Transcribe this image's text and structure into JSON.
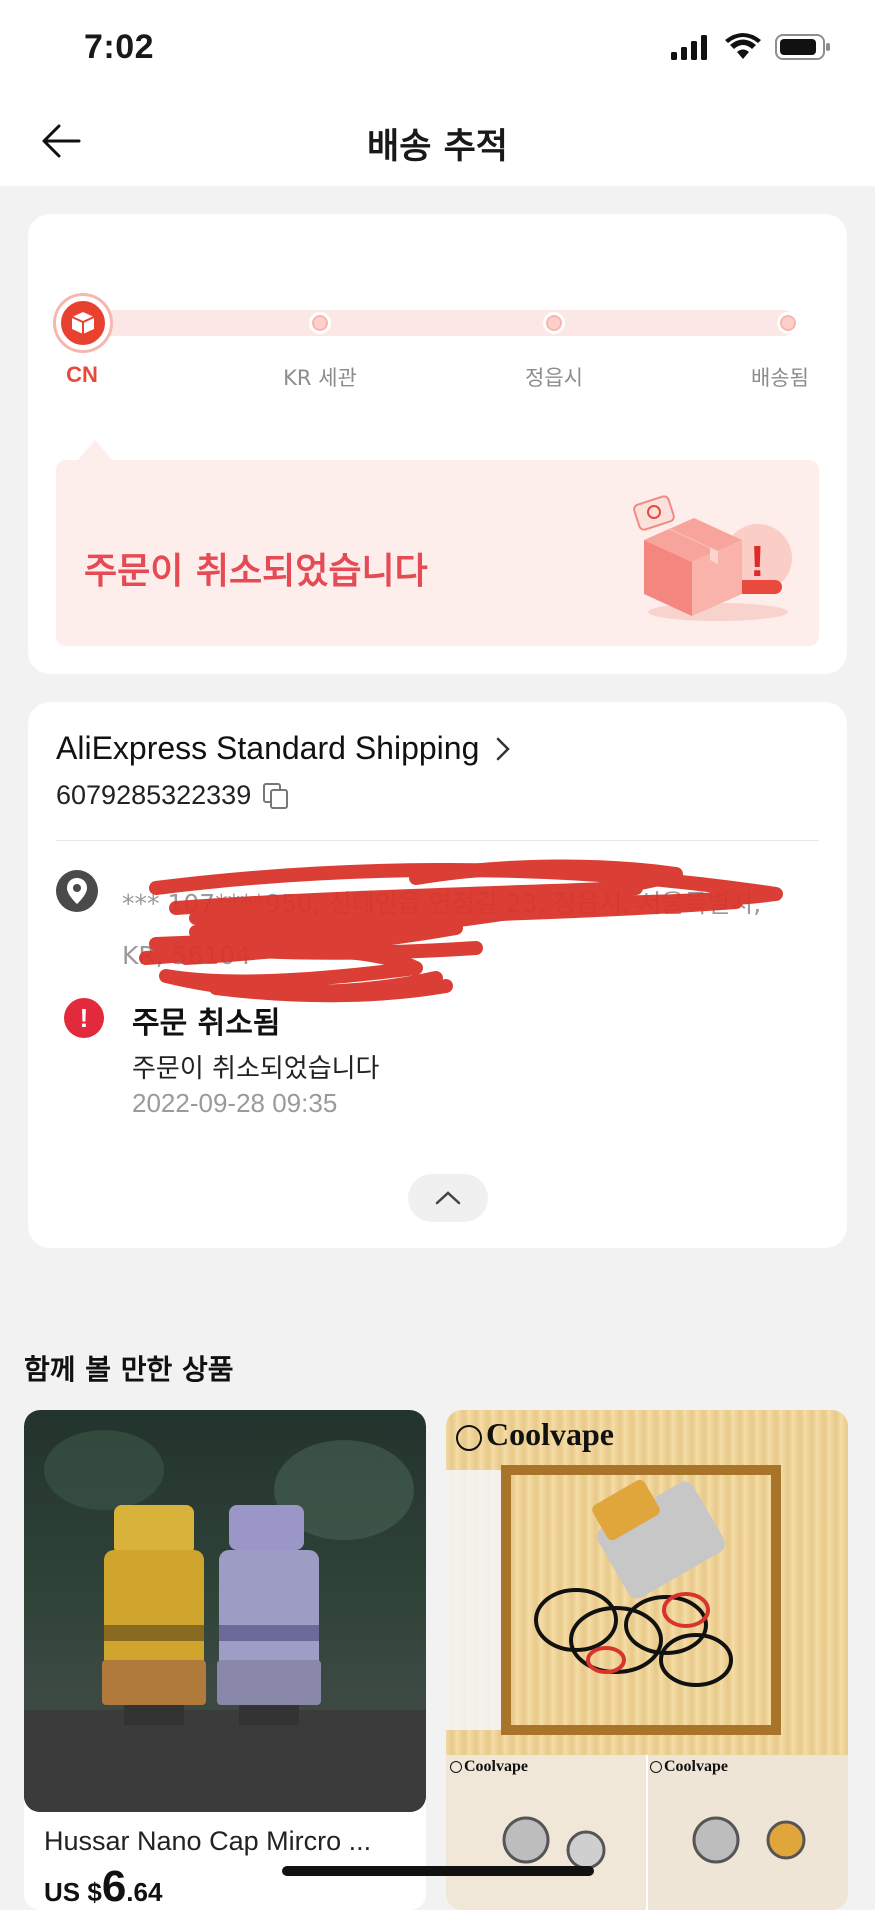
{
  "status_bar": {
    "time": "7:02"
  },
  "header": {
    "title": "배송 추적"
  },
  "tracking": {
    "steps": [
      {
        "label": "CN"
      },
      {
        "label": "KR 세관"
      },
      {
        "label": "정읍시"
      },
      {
        "label": "배송됨"
      }
    ],
    "banner_text": "주문이 취소되었습니다"
  },
  "shipping": {
    "carrier": "AliExpress Standard Shipping",
    "tracking_number": "6079285322339",
    "address": "*** 107****950, 신태인읍 연정길 23, 정읍시, 서울특별시, KR, 56104",
    "event": {
      "title": "주문 취소됨",
      "description": "주문이 취소되었습니다",
      "time": "2022-09-28 09:35"
    }
  },
  "recommend": {
    "title": "함께 볼 만한 상품",
    "products": [
      {
        "name": "Hussar Nano Cap Mircro ...",
        "currency": "US $",
        "price_int": "6",
        "price_dec": ".64"
      },
      {
        "brand": "Coolvape"
      }
    ]
  },
  "colors": {
    "accent": "#e8412f",
    "banner_bg": "#fdeeec",
    "banner_text": "#e54b55",
    "alert": "#e22a3c"
  }
}
